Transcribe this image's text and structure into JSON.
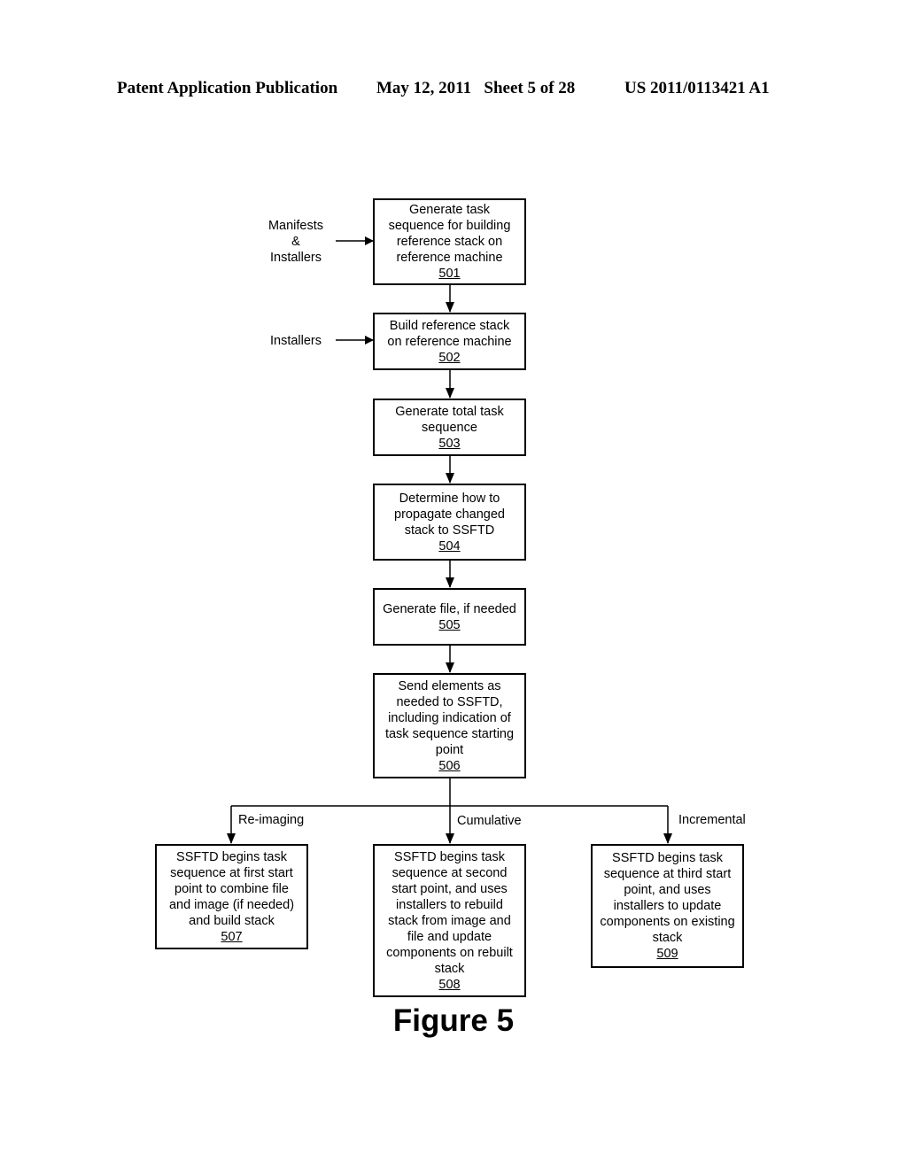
{
  "header": {
    "publication": "Patent Application Publication",
    "date_sheet": "May 12, 2011   Sheet 5 of 28",
    "patent_number": "US 2011/0113421 A1"
  },
  "inputs": {
    "manifests_installers": "Manifests\n&\nInstallers",
    "installers": "Installers"
  },
  "steps": [
    {
      "text": "Generate task\nsequence for building\nreference stack on\nreference machine",
      "ref": "501"
    },
    {
      "text": "Build reference stack\non reference machine",
      "ref": "502"
    },
    {
      "text": "Generate total task\nsequence",
      "ref": "503"
    },
    {
      "text": "Determine how to\npropagate changed\nstack to SSFTD",
      "ref": "504"
    },
    {
      "text": "Generate file, if needed",
      "ref": "505"
    },
    {
      "text": "Send elements as\nneeded to SSFTD,\nincluding indication of\ntask sequence starting\npoint",
      "ref": "506"
    },
    {
      "text": "SSFTD begins task\nsequence at first start\npoint to combine file\nand image (if needed)\nand build stack",
      "ref": "507"
    },
    {
      "text": "SSFTD begins task\nsequence at second\nstart point, and uses\ninstallers to rebuild\nstack from image and\nfile and update\ncomponents on rebuilt\nstack",
      "ref": "508"
    },
    {
      "text": "SSFTD begins task\nsequence at third start\npoint, and uses\ninstallers to update\ncomponents on existing\nstack",
      "ref": "509"
    }
  ],
  "branches": {
    "reimaging": "Re-imaging",
    "cumulative": "Cumulative",
    "incremental": "Incremental"
  },
  "figure_caption": "Figure 5"
}
